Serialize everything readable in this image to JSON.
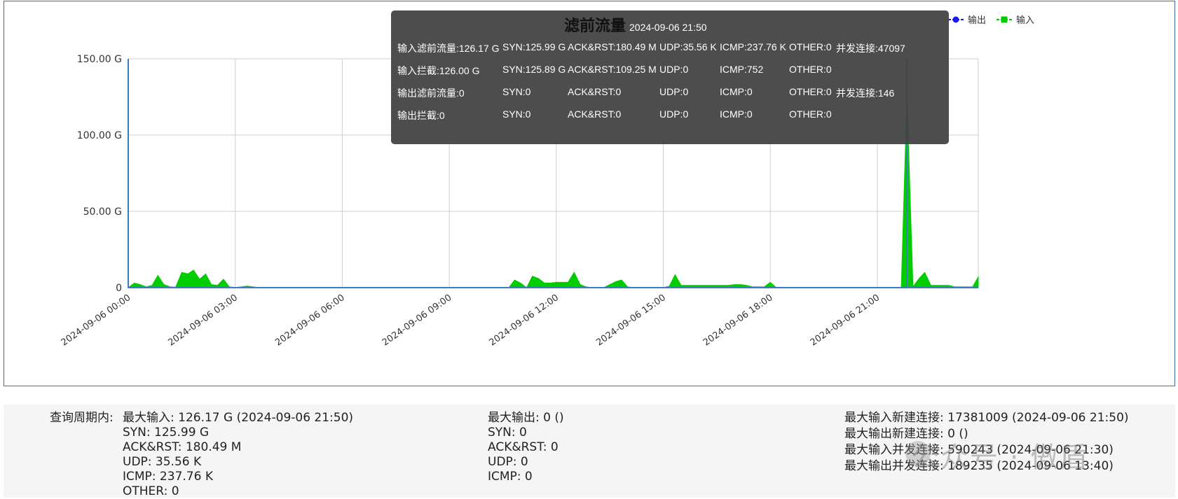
{
  "chart_data": {
    "type": "area",
    "title": "滤前流量",
    "yticks": [
      "0",
      "50.00 G",
      "100.00 G",
      "150.00 G"
    ],
    "ylim": [
      0,
      150
    ],
    "xticks": [
      "2024-09-06 00:00",
      "2024-09-06 03:00",
      "2024-09-06 06:00",
      "2024-09-06 09:00",
      "2024-09-06 12:00",
      "2024-09-06 15:00",
      "2024-09-06 18:00",
      "2024-09-06 21:00"
    ],
    "xlim_hours": [
      0,
      23.83
    ],
    "grid": true,
    "legend_position": "top-right",
    "series": [
      {
        "name": "输出",
        "color": "#1a1aee",
        "x_hours": [
          0,
          23.83
        ],
        "values": [
          0,
          0
        ]
      },
      {
        "name": "输入",
        "color": "#00cc00",
        "x_hours": [
          0,
          0.17,
          0.33,
          0.5,
          0.67,
          0.83,
          1.0,
          1.17,
          1.33,
          1.5,
          1.67,
          1.83,
          2.0,
          2.17,
          2.33,
          2.5,
          2.67,
          2.83,
          3.0,
          3.17,
          3.33,
          3.5,
          3.67,
          10.67,
          10.83,
          11.0,
          11.17,
          11.33,
          11.5,
          11.67,
          11.83,
          12.0,
          12.17,
          12.33,
          12.5,
          12.67,
          12.83,
          13.0,
          13.33,
          13.67,
          13.83,
          14.0,
          14.17,
          14.33,
          14.67,
          15.0,
          15.17,
          15.33,
          15.5,
          15.67,
          15.83,
          16.0,
          16.17,
          16.5,
          16.83,
          17.0,
          17.17,
          17.33,
          17.5,
          17.67,
          17.83,
          18.0,
          18.17,
          21.5,
          21.67,
          21.83,
          22.0,
          22.17,
          22.33,
          22.5,
          22.67,
          22.83,
          23.0,
          23.17,
          23.33,
          23.5,
          23.67,
          23.83
        ],
        "values": [
          0,
          3,
          2,
          0.5,
          1.5,
          8,
          2,
          0.5,
          0.3,
          10,
          9,
          11.5,
          5.5,
          9,
          2,
          1.5,
          5.5,
          0.5,
          0.2,
          0.5,
          1,
          0.5,
          0,
          0,
          5,
          3,
          0,
          7.5,
          6,
          3,
          3,
          3.5,
          3.5,
          3.5,
          10,
          2,
          0.5,
          0,
          0,
          4,
          5,
          0.5,
          0,
          0,
          0,
          0,
          1,
          8.5,
          1.5,
          1.5,
          1.5,
          1.5,
          1.5,
          1.5,
          1.5,
          2,
          2,
          1.5,
          0.5,
          0.5,
          0.5,
          3.5,
          0,
          0,
          0,
          126,
          0.5,
          6,
          10,
          1.5,
          1.5,
          1.5,
          1.5,
          0.5,
          0.5,
          0.5,
          0.5,
          7
        ]
      }
    ],
    "spike_line_hours": 21.83,
    "tooltip": {
      "time": "2024-09-06 21:50",
      "rows": [
        [
          "输入滤前流量:126.17 G",
          "SYN:125.99 G",
          "ACK&RST:180.49 M",
          "UDP:35.56 K",
          "ICMP:237.76 K",
          "OTHER:0",
          "并发连接:47097"
        ],
        [
          "输入拦截:126.00 G",
          "SYN:125.89 G",
          "ACK&RST:109.25 M",
          "UDP:0",
          "ICMP:752",
          "OTHER:0",
          ""
        ],
        [
          "输出滤前流量:0",
          "SYN:0",
          "ACK&RST:0",
          "UDP:0",
          "ICMP:0",
          "OTHER:0",
          "并发连接:146"
        ],
        [
          "输出拦截:0",
          "SYN:0",
          "ACK&RST:0",
          "UDP:0",
          "ICMP:0",
          "OTHER:0",
          ""
        ]
      ]
    }
  },
  "stats": {
    "period_label": "查询周期内:",
    "input": {
      "max": "最大输入: 126.17 G (2024-09-06 21:50)",
      "syn": "SYN: 125.99 G",
      "ack": "ACK&RST: 180.49 M",
      "udp": "UDP: 35.56 K",
      "icmp": "ICMP: 237.76 K",
      "other": "OTHER: 0"
    },
    "output": {
      "max": "最大输出: 0 ()",
      "syn": "SYN: 0",
      "ack": "ACK&RST: 0",
      "udp": "UDP: 0",
      "icmp": "ICMP: 0"
    },
    "connections": {
      "in_new": "最大输入新建连接: 17381009 (2024-09-06 21:50)",
      "out_new": "最大输出新建连接: 0 ()",
      "in_concurrent": "最大输入并发连接: 590243 (2024-09-06 21:30)",
      "out_concurrent": "最大输出并发连接: 189235 (2024-09-06 13:40)"
    }
  },
  "watermark": "公众号 · 傲盾"
}
